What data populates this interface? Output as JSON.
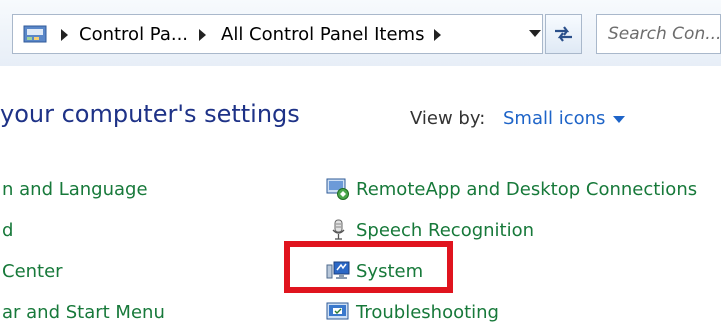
{
  "address_bar": {
    "breadcrumbs": [
      "Control Pa...",
      "All Control Panel Items"
    ],
    "search_placeholder": "Search Con..."
  },
  "header": {
    "title": "your computer's settings",
    "view_by_label": "View by:",
    "view_by_value": "Small icons"
  },
  "left_items": [
    {
      "label": "n and Language"
    },
    {
      "label": "d"
    },
    {
      "label": "Center"
    },
    {
      "label": "ar and Start Menu"
    }
  ],
  "right_items": [
    {
      "label": "RemoteApp and Desktop Connections",
      "icon": "remoteapp-icon"
    },
    {
      "label": "Speech Recognition",
      "icon": "microphone-icon"
    },
    {
      "label": "System",
      "icon": "system-icon"
    },
    {
      "label": "Troubleshooting",
      "icon": "troubleshooting-icon"
    }
  ],
  "colors": {
    "item_text": "#17793a",
    "heading_text": "#1e3287",
    "link_blue": "#1e64c8",
    "highlight": "#e0141e"
  }
}
